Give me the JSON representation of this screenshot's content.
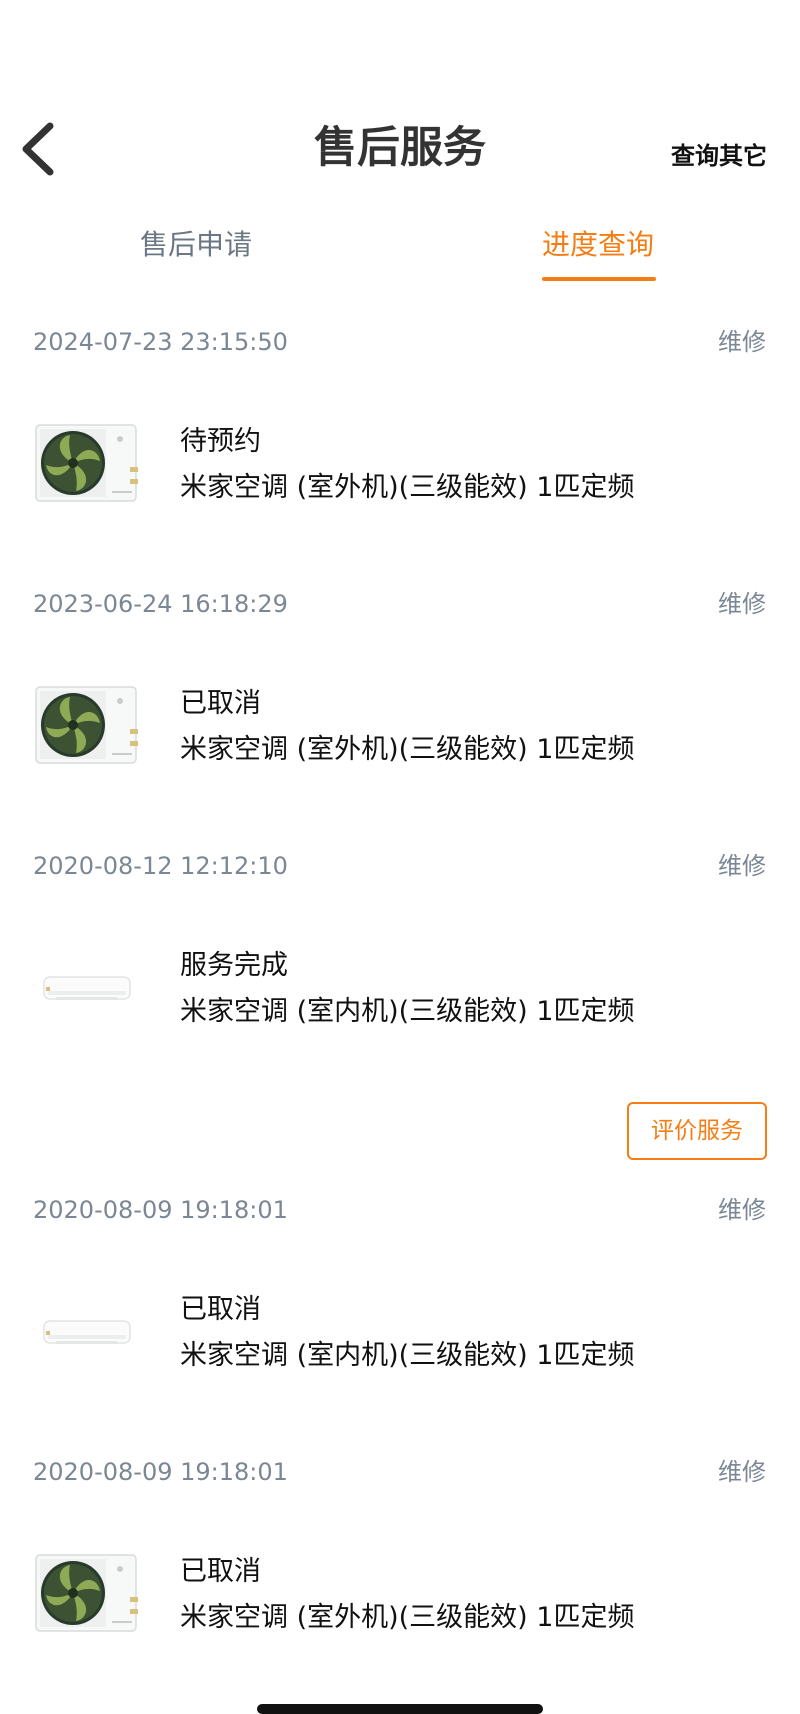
{
  "header": {
    "title": "售后服务",
    "back_icon": "chevron-left-icon",
    "right_link": "查询其它"
  },
  "tabs": [
    {
      "label": "售后申请",
      "active": false
    },
    {
      "label": "进度查询",
      "active": true
    }
  ],
  "colors": {
    "accent": "#f57d14",
    "muted_text": "#7b8794",
    "tab_inactive": "#6b7785"
  },
  "orders": [
    {
      "datetime": "2024-07-23 23:15:50",
      "type": "维修",
      "status": "待预约",
      "product": "米家空调 (室外机)(三级能效) 1匹定频",
      "image_icon": "outdoor-ac-unit-icon"
    },
    {
      "datetime": "2023-06-24 16:18:29",
      "type": "维修",
      "status": "已取消",
      "product": "米家空调 (室外机)(三级能效) 1匹定频",
      "image_icon": "outdoor-ac-unit-icon"
    },
    {
      "datetime": "2020-08-12 12:12:10",
      "type": "维修",
      "status": "服务完成",
      "product": "米家空调 (室内机)(三级能效) 1匹定频",
      "image_icon": "indoor-ac-unit-icon",
      "action": "评价服务"
    },
    {
      "datetime": "2020-08-09 19:18:01",
      "type": "维修",
      "status": "已取消",
      "product": "米家空调 (室内机)(三级能效) 1匹定频",
      "image_icon": "indoor-ac-unit-icon"
    },
    {
      "datetime": "2020-08-09 19:18:01",
      "type": "维修",
      "status": "已取消",
      "product": "米家空调 (室外机)(三级能效) 1匹定频",
      "image_icon": "outdoor-ac-unit-icon"
    }
  ]
}
